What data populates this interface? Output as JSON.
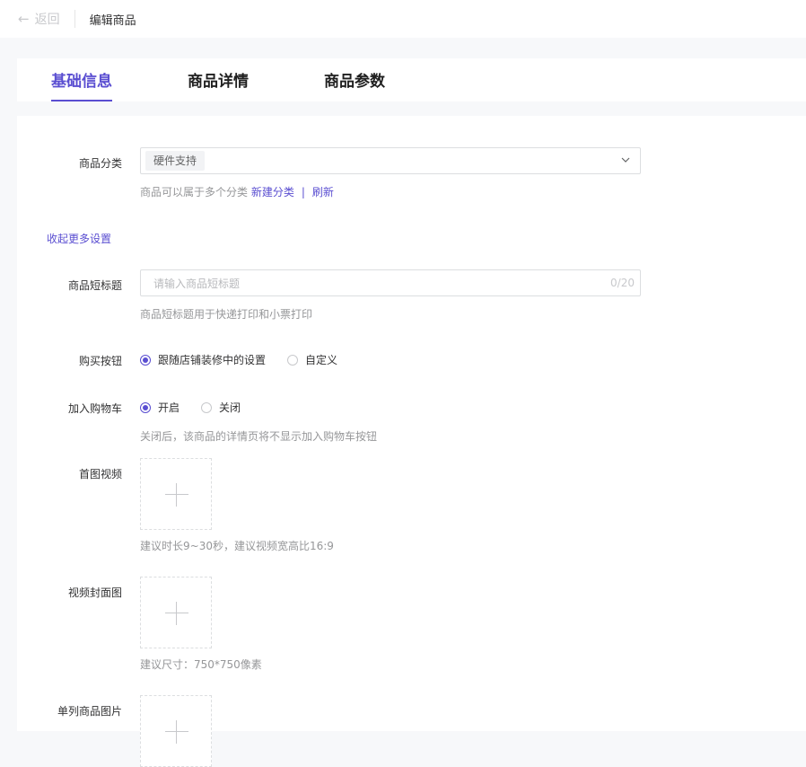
{
  "topbar": {
    "back_label": "返回",
    "breadcrumb": "编辑商品"
  },
  "tabs": [
    {
      "label": "基础信息",
      "active": true
    },
    {
      "label": "商品详情",
      "active": false
    },
    {
      "label": "商品参数",
      "active": false
    }
  ],
  "form": {
    "category": {
      "label": "商品分类",
      "selected_tag": "硬件支持",
      "help_text": "商品可以属于多个分类",
      "new_link": "新建分类",
      "separator": "|",
      "refresh_link": "刷新"
    },
    "collapse_link": "收起更多设置",
    "short_title": {
      "label": "商品短标题",
      "placeholder": "请输入商品短标题",
      "value": "",
      "counter": "0/20",
      "help_text": "商品短标题用于快递打印和小票打印"
    },
    "buy_button": {
      "label": "购买按钮",
      "options": [
        {
          "label": "跟随店铺装修中的设置",
          "checked": true
        },
        {
          "label": "自定义",
          "checked": false
        }
      ]
    },
    "add_to_cart": {
      "label": "加入购物车",
      "options": [
        {
          "label": "开启",
          "checked": true
        },
        {
          "label": "关闭",
          "checked": false
        }
      ],
      "help_text": "关闭后，该商品的详情页将不显示加入购物车按钮"
    },
    "main_video": {
      "label": "首图视频",
      "help_text": "建议时长9~30秒，建议视频宽高比16:9"
    },
    "video_cover": {
      "label": "视频封面图",
      "help_text": "建议尺寸：750*750像素"
    },
    "single_image": {
      "label": "单列商品图片"
    }
  },
  "icons": {
    "back": "arrow-left-icon",
    "dropdown": "chevron-down-icon",
    "upload": "plus-icon"
  },
  "colors": {
    "accent": "#5a4ed1",
    "page_bg": "#f7f8fa",
    "border": "#dcdee0",
    "muted_text": "#969799"
  }
}
